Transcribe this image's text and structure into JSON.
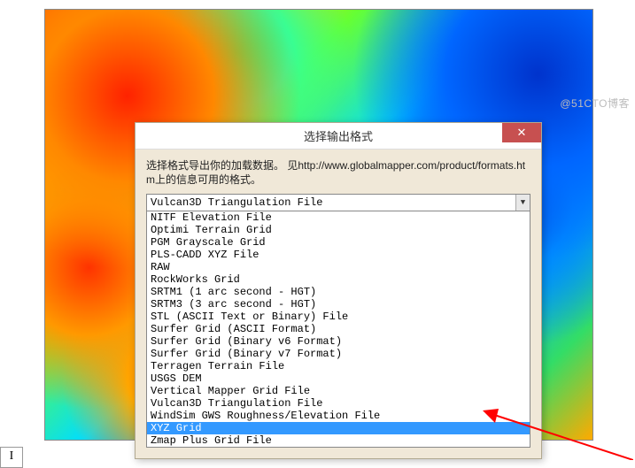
{
  "watermark": "@51CTO博客",
  "dialog": {
    "title": "选择输出格式",
    "instruction": "选择格式导出你的加载数据。 见http://www.globalmapper.com/product/formats.htm上的信息可用的格式。",
    "selected": "Vulcan3D Triangulation File",
    "options": [
      "NITF Elevation File",
      "Optimi Terrain Grid",
      "PGM Grayscale Grid",
      "PLS-CADD XYZ File",
      "RAW",
      "RockWorks Grid",
      "SRTM1 (1 arc second - HGT)",
      "SRTM3 (3 arc second - HGT)",
      "STL (ASCII Text or Binary) File",
      "Surfer Grid (ASCII Format)",
      "Surfer Grid (Binary v6 Format)",
      "Surfer Grid (Binary v7 Format)",
      "Terragen Terrain File",
      "USGS DEM",
      "Vertical Mapper Grid File",
      "Vulcan3D Triangulation File",
      "WindSim GWS Roughness/Elevation File",
      "XYZ Grid",
      "Zmap Plus Grid File"
    ],
    "highlighted_index": 17,
    "close_label": "✕"
  },
  "caret": "I"
}
